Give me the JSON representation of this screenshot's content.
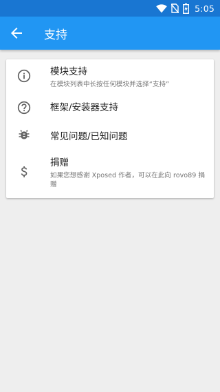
{
  "status_bar": {
    "time": "5:05",
    "icons": [
      "wifi-icon",
      "no-sim-icon",
      "battery-charging-icon"
    ]
  },
  "toolbar": {
    "title": "支持",
    "back_icon": "arrow-back-icon"
  },
  "colors": {
    "status_bar": "#1976d2",
    "toolbar": "#2196f3",
    "background": "#eeeeee",
    "card": "#ffffff",
    "icon": "#616161"
  },
  "support": {
    "items": [
      {
        "icon": "info-icon",
        "title": "模块支持",
        "summary": "在模块列表中长按任何模块并选择“支持”"
      },
      {
        "icon": "help-icon",
        "title": "框架/安装器支持",
        "summary": ""
      },
      {
        "icon": "bug-icon",
        "title": "常见问题/已知问题",
        "summary": ""
      },
      {
        "icon": "dollar-icon",
        "title": "捐赠",
        "summary": "如果您想感谢 Xposed 作者，可以在此向 rovo89 捐赠"
      }
    ]
  }
}
